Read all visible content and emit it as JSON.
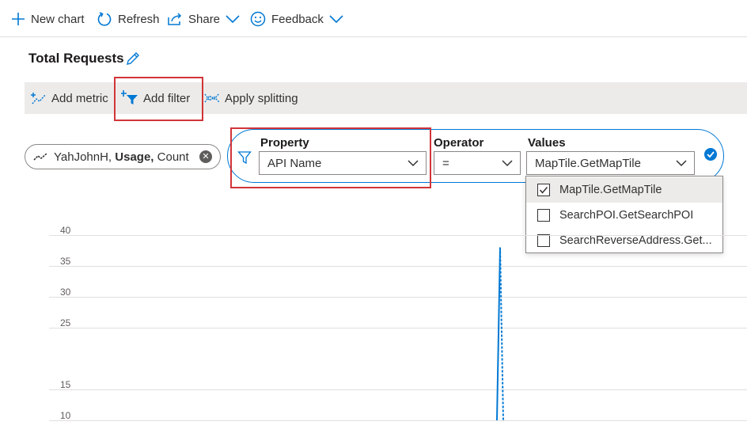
{
  "toolbar": {
    "new_chart": "New chart",
    "refresh": "Refresh",
    "share": "Share",
    "feedback": "Feedback"
  },
  "chart_title": "Total Requests",
  "commands": {
    "add_metric": "Add metric",
    "add_filter": "Add filter",
    "apply_splitting": "Apply splitting"
  },
  "metric_pill": {
    "resource": "YahJohnH,",
    "metric": "Usage,",
    "aggregation": "Count"
  },
  "filter": {
    "property_label": "Property",
    "property_value": "API Name",
    "operator_label": "Operator",
    "operator_value": "=",
    "values_label": "Values",
    "values_value": "MapTile.GetMapTile"
  },
  "values_options": [
    {
      "label": "MapTile.GetMapTile",
      "checked": true
    },
    {
      "label": "SearchPOI.GetSearchPOI",
      "checked": false
    },
    {
      "label": "SearchReverseAddress.Get...",
      "checked": false
    }
  ],
  "colors": {
    "accent": "#0078d4",
    "highlight": "#d13438"
  },
  "chart_data": {
    "type": "line",
    "yticks": [
      "40",
      "35",
      "30",
      "25",
      "15",
      "10"
    ],
    "ylim": [
      10,
      40
    ],
    "series": [
      {
        "values": [
          10,
          38,
          10
        ]
      }
    ]
  }
}
